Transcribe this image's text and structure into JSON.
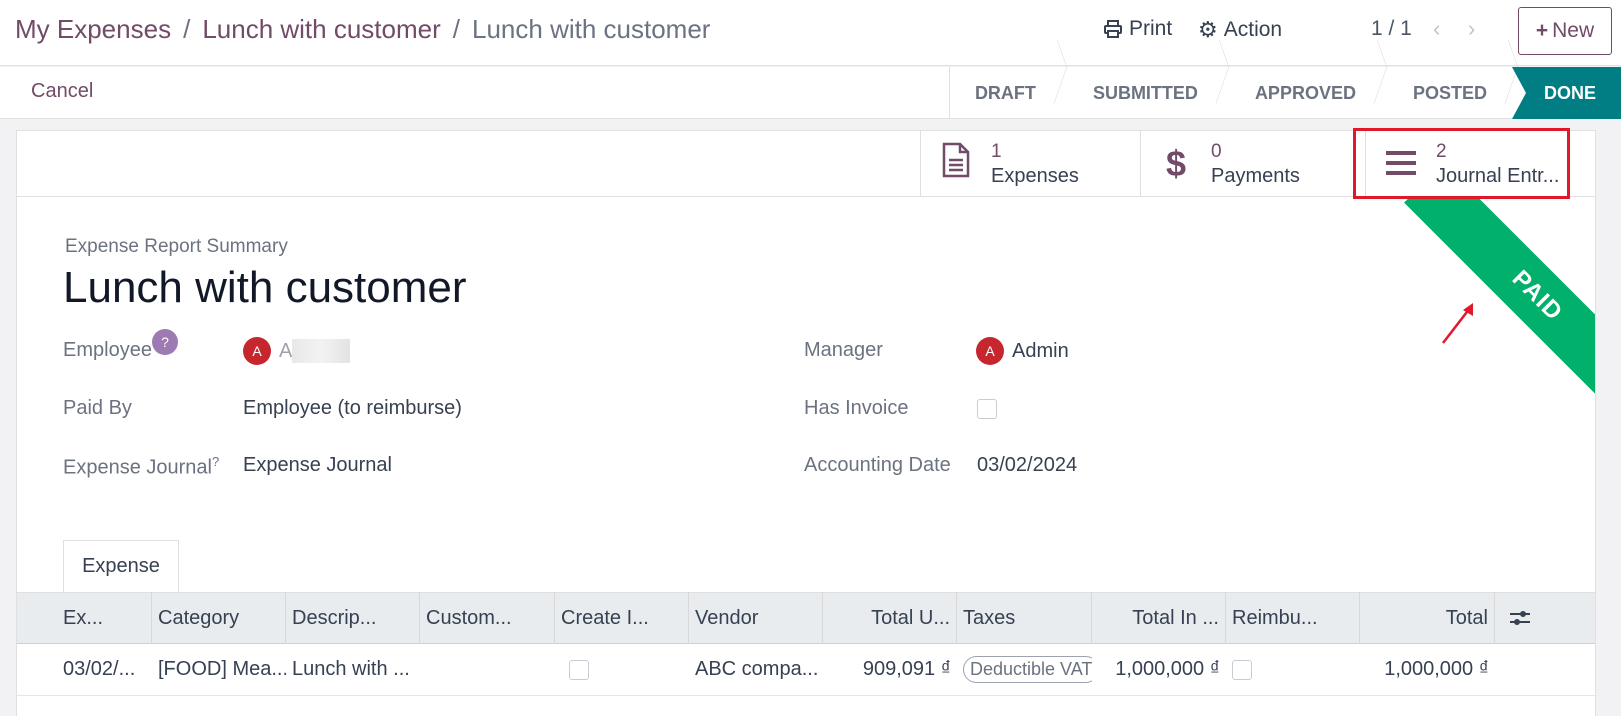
{
  "breadcrumb": {
    "items": [
      "My Expenses",
      "Lunch with customer"
    ],
    "separator": "/",
    "current": "Lunch with customer"
  },
  "toolbar": {
    "print_label": "Print",
    "action_label": "Action",
    "pager": "1 / 1",
    "new_label": "New"
  },
  "status": {
    "cancel_label": "Cancel",
    "stages": [
      "DRAFT",
      "SUBMITTED",
      "APPROVED",
      "POSTED",
      "DONE"
    ],
    "active_stage": "DONE"
  },
  "smart_buttons": [
    {
      "count": "1",
      "label": "Expenses",
      "icon": "document-icon"
    },
    {
      "count": "0",
      "label": "Payments",
      "icon": "dollar-icon"
    },
    {
      "count": "2",
      "label": "Journal Entr...",
      "icon": "list-icon"
    }
  ],
  "ribbon": "PAID",
  "form": {
    "summary_label": "Expense Report Summary",
    "title": "Lunch with customer",
    "employee_label": "Employee",
    "employee_help": "?",
    "employee_avatar": "A",
    "employee_value": "A",
    "paid_by_label": "Paid By",
    "paid_by_value": "Employee (to reimburse)",
    "journal_label": "Expense Journal",
    "journal_help": "?",
    "journal_value": "Expense Journal",
    "manager_label": "Manager",
    "manager_avatar": "A",
    "manager_value": "Admin",
    "has_invoice_label": "Has Invoice",
    "has_invoice": false,
    "accounting_date_label": "Accounting Date",
    "accounting_date_value": "03/02/2024"
  },
  "tab": {
    "label": "Expense"
  },
  "table": {
    "headers": [
      "Ex...",
      "Category",
      "Descrip...",
      "Custom...",
      "Create I...",
      "Vendor",
      "Total U...",
      "Taxes",
      "Total In ...",
      "Reimbu...",
      "Total"
    ],
    "rows": [
      {
        "date": "03/02/...",
        "category": "[FOOD] Mea...",
        "description": "Lunch with ...",
        "customer": "",
        "create_invoice": false,
        "vendor": "ABC compa...",
        "total_untaxed": "909,091 ₫",
        "taxes": "Deductible VAT",
        "total_incl": "1,000,000 ₫",
        "reimbursed": false,
        "total": "1,000,000 ₫"
      }
    ]
  },
  "colors": {
    "brand": "#714b67",
    "done_stage": "#017e84",
    "ribbon": "#00b06b",
    "highlight": "#e0182a"
  }
}
